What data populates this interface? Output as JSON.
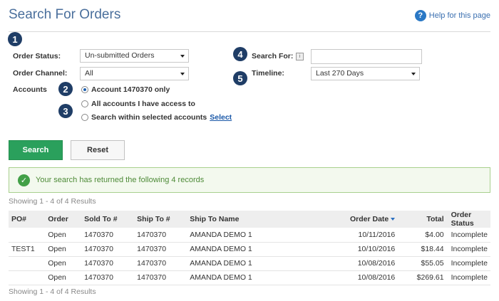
{
  "header": {
    "title": "Search For Orders",
    "help_icon": "question-circle-icon",
    "help_icon_glyph": "?",
    "help_link": "Help for this page"
  },
  "callouts": [
    "1",
    "2",
    "3",
    "4",
    "5"
  ],
  "form": {
    "order_status_label": "Order Status:",
    "order_status_value": "Un-submitted Orders",
    "order_channel_label": "Order Channel:",
    "order_channel_value": "All",
    "accounts_label": "Accounts",
    "account_options": [
      {
        "label": "Account 1470370 only",
        "selected": true
      },
      {
        "label": "All accounts I have access to",
        "selected": false
      },
      {
        "label": "Search within selected accounts",
        "selected": false,
        "link": "Select"
      }
    ],
    "search_for_label": "Search For:",
    "search_for_value": "",
    "timeline_label": "Timeline:",
    "timeline_value": "Last 270 Days"
  },
  "buttons": {
    "search": "Search",
    "reset": "Reset"
  },
  "alert": {
    "icon": "check-circle-icon",
    "icon_glyph": "✓",
    "message": "Your search has returned the following 4 records"
  },
  "results": {
    "showing_top": "Showing 1 - 4 of 4 Results",
    "showing_bottom": "Showing 1 - 4 of 4 Results",
    "columns": [
      "PO#",
      "Order",
      "Sold To #",
      "Ship To #",
      "Ship To Name",
      "Order Date",
      "Total",
      "Order Status"
    ],
    "sort_column": "Order Date",
    "rows": [
      {
        "po": "",
        "order": "Open",
        "sold_to": "1470370",
        "ship_to": "1470370",
        "ship_name": "AMANDA DEMO 1",
        "date": "10/11/2016",
        "total": "$4.00",
        "status": "Incomplete"
      },
      {
        "po": "TEST1",
        "order": "Open",
        "sold_to": "1470370",
        "ship_to": "1470370",
        "ship_name": "AMANDA DEMO 1",
        "date": "10/10/2016",
        "total": "$18.44",
        "status": "Incomplete"
      },
      {
        "po": "",
        "order": "Open",
        "sold_to": "1470370",
        "ship_to": "1470370",
        "ship_name": "AMANDA DEMO 1",
        "date": "10/08/2016",
        "total": "$55.05",
        "status": "Incomplete"
      },
      {
        "po": "",
        "order": "Open",
        "sold_to": "1470370",
        "ship_to": "1470370",
        "ship_name": "AMANDA DEMO 1",
        "date": "10/08/2016",
        "total": "$269.61",
        "status": "Incomplete"
      }
    ]
  },
  "colors": {
    "accent_blue": "#4a6f9c",
    "callout_navy": "#1f3d66",
    "search_green": "#2aa05c",
    "alert_green": "#4d8a37",
    "link_blue": "#2a6fc0"
  }
}
